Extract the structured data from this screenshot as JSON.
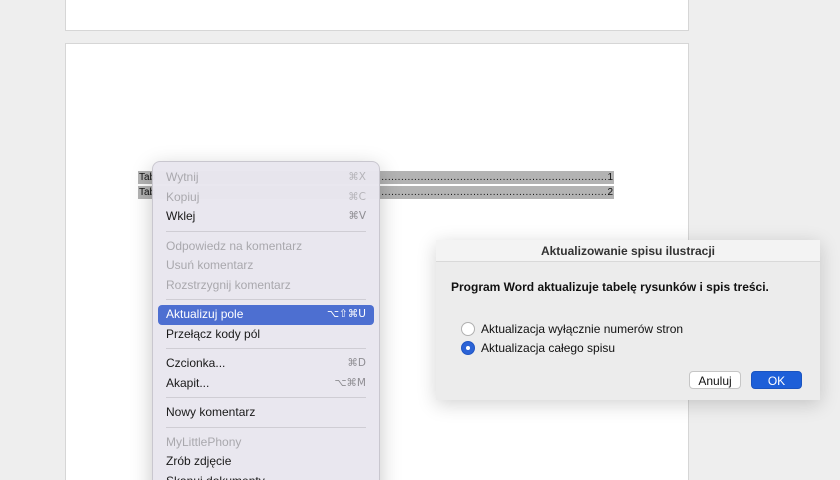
{
  "document": {
    "toc": [
      {
        "label": "Tab",
        "dots": "...................................................................................................................................",
        "page": "1"
      },
      {
        "label": "Tab",
        "dots": "...................................................................................................................................",
        "page": "2"
      }
    ]
  },
  "context_menu": {
    "items": [
      {
        "label": "Wytnij",
        "shortcut": "⌘X",
        "enabled": false
      },
      {
        "label": "Kopiuj",
        "shortcut": "⌘C",
        "enabled": false
      },
      {
        "label": "Wklej",
        "shortcut": "⌘V",
        "enabled": true
      },
      {
        "label": "Odpowiedz na komentarz",
        "shortcut": "",
        "enabled": false
      },
      {
        "label": "Usuń komentarz",
        "shortcut": "",
        "enabled": false
      },
      {
        "label": "Rozstrzygnij komentarz",
        "shortcut": "",
        "enabled": false
      },
      {
        "label": "Aktualizuj pole",
        "shortcut": "⌥⇧⌘U",
        "enabled": true,
        "highlighted": true
      },
      {
        "label": "Przełącz kody pól",
        "shortcut": "",
        "enabled": true
      },
      {
        "label": "Czcionka...",
        "shortcut": "⌘D",
        "enabled": true
      },
      {
        "label": "Akapit...",
        "shortcut": "⌥⌘M",
        "enabled": true
      },
      {
        "label": "Nowy komentarz",
        "shortcut": "",
        "enabled": true
      },
      {
        "label": "MyLittlePhony",
        "shortcut": "",
        "enabled": false
      },
      {
        "label": "Zrób zdjęcie",
        "shortcut": "",
        "enabled": true
      },
      {
        "label": "Skanuj dokumenty",
        "shortcut": "",
        "enabled": true
      }
    ]
  },
  "dialog": {
    "title": "Aktualizowanie spisu ilustracji",
    "message": "Program Word aktualizuje tabelę rysunków i spis treści.",
    "options": [
      {
        "label": "Aktualizacja wyłącznie numerów stron",
        "selected": false
      },
      {
        "label": "Aktualizacja całego spisu",
        "selected": true
      }
    ],
    "cancel_label": "Anuluj",
    "ok_label": "OK"
  },
  "colors": {
    "highlight": "#4d6fd1",
    "primary_button": "#1d5fd8",
    "selection": "#b3b3b3"
  }
}
